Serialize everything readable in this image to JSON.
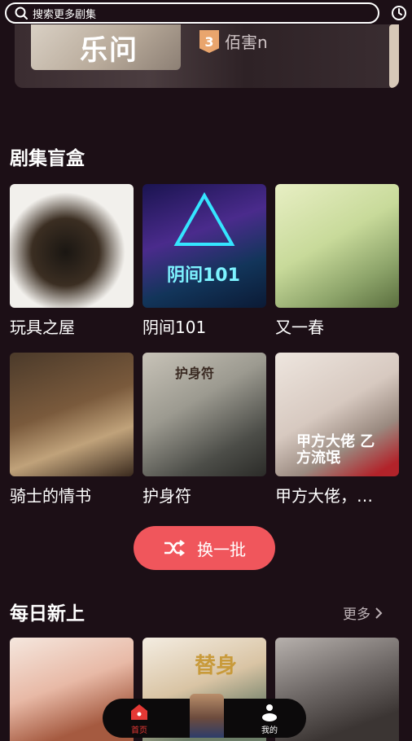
{
  "search": {
    "placeholder": "搜索更多剧集",
    "icon": "search-icon"
  },
  "header": {
    "history_icon": "clock-icon"
  },
  "banner": {
    "cover_text": "乐问",
    "rank": "3",
    "title": "佰害n"
  },
  "blind_box": {
    "title": "剧集盲盒",
    "items": [
      {
        "label": "玩具之屋",
        "overlay": ""
      },
      {
        "label": "阴间101",
        "overlay": "阴间101"
      },
      {
        "label": "又一春",
        "overlay": ""
      },
      {
        "label": "骑士的情书",
        "overlay": ""
      },
      {
        "label": "护身符",
        "overlay": "护身符"
      },
      {
        "label": "甲方大佬，…",
        "overlay": "甲方大佬 乙方流氓"
      }
    ],
    "shuffle_label": "换一批"
  },
  "daily": {
    "title": "每日新上",
    "more_label": "更多",
    "items": [
      {
        "overlay": ""
      },
      {
        "overlay": "替身"
      },
      {
        "overlay": ""
      }
    ]
  },
  "tabbar": {
    "tabs": [
      {
        "label": "首页",
        "active": true,
        "icon": "home-icon"
      },
      {
        "label": "我的",
        "active": false,
        "icon": "profile-icon"
      }
    ]
  },
  "colors": {
    "accent": "#f0565c",
    "background": "#1c0f16",
    "tab_active": "#e53935"
  }
}
